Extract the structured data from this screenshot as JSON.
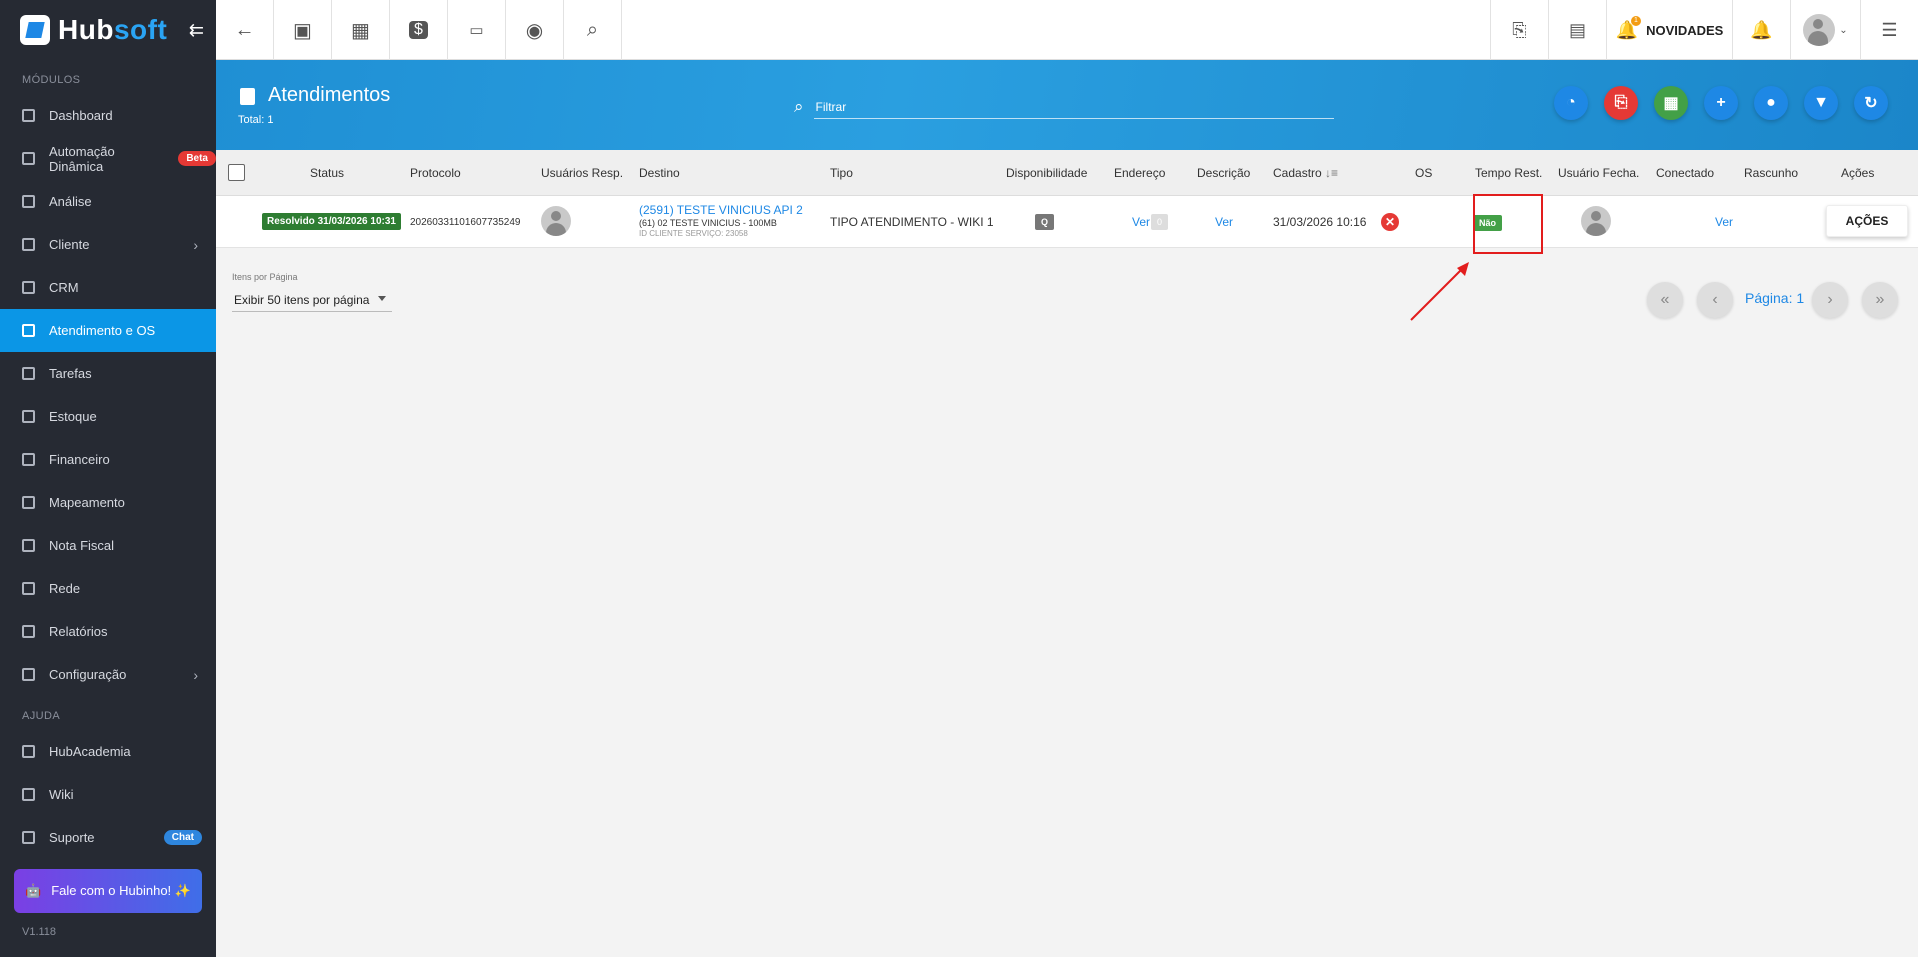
{
  "app": {
    "name_part1": "Hub",
    "name_part2": "soft"
  },
  "sidebar": {
    "section_modules": "MÓDULOS",
    "section_help": "AJUDA",
    "items": [
      {
        "label": "Dashboard"
      },
      {
        "label": "Automação Dinâmica",
        "badge": "Beta"
      },
      {
        "label": "Análise"
      },
      {
        "label": "Cliente"
      },
      {
        "label": "CRM"
      },
      {
        "label": "Atendimento e OS"
      },
      {
        "label": "Tarefas"
      },
      {
        "label": "Estoque"
      },
      {
        "label": "Financeiro"
      },
      {
        "label": "Mapeamento"
      },
      {
        "label": "Nota Fiscal"
      },
      {
        "label": "Rede"
      },
      {
        "label": "Relatórios"
      },
      {
        "label": "Configuração"
      }
    ],
    "help_items": [
      {
        "label": "HubAcademia"
      },
      {
        "label": "Wiki"
      },
      {
        "label": "Suporte",
        "badge": "Chat"
      }
    ],
    "hubinho_label": "Fale com o Hubinho! ✨",
    "version": "V1.118"
  },
  "topbar": {
    "novidades": "NOVIDADES",
    "notification_count": "1"
  },
  "header": {
    "title": "Atendimentos",
    "total": "Total: 1",
    "search_placeholder": "Filtrar",
    "accent": "#1f8fd4"
  },
  "table": {
    "columns": [
      "Status",
      "Protocolo",
      "Usuários Resp.",
      "Destino",
      "Tipo",
      "Disponibilidade",
      "Endereço",
      "Descrição",
      "Cadastro",
      "OS",
      "Tempo Rest.",
      "Usuário Fecha.",
      "Conectado",
      "Rascunho",
      "Ações"
    ],
    "rows": [
      {
        "status": "Resolvido 31/03/2026 10:31",
        "protocolo": "20260331101607735249",
        "destino_main": "(2591) TESTE VINICIUS API 2",
        "destino_sub": "(61) 02 TESTE VINICIUS - 100MB",
        "destino_id": "ID CLIENTE SERVIÇO: 23058",
        "tipo": "TIPO ATENDIMENTO - WIKI 1",
        "disponibilidade": "Q",
        "endereco": "Ver",
        "descricao": "Ver",
        "cadastro": "31/03/2026 10:16",
        "os": "0",
        "tempo_rest": "Ver",
        "rascunho": "Não",
        "acoes": "AÇÕES"
      }
    ]
  },
  "pagination": {
    "per_page_label": "Itens por Página",
    "per_page_value": "Exibir 50 itens por página",
    "page_label": "Página: 1"
  }
}
